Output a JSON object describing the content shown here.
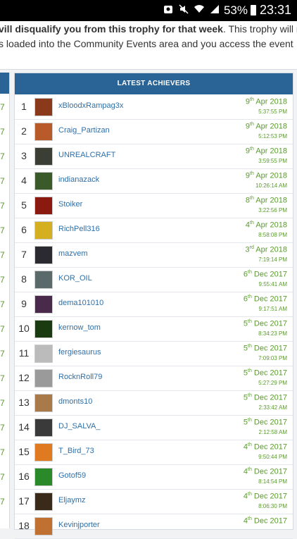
{
  "status_bar": {
    "battery_pct": "53%",
    "time": "23:31"
  },
  "intro": {
    "line1_bold": "vill disqualify you from this trophy for that week",
    "line1_rest": ". This trophy will not",
    "line2": "s loaded into the Community Events area and you access the event"
  },
  "left_column": {
    "number": "7"
  },
  "panel": {
    "title": "LATEST ACHIEVERS",
    "rows": [
      {
        "rank": "1",
        "user": "xBloodxRampag3x",
        "day": "9",
        "sfx": "th",
        "mon": "Apr 2018",
        "time": "5:37:55 PM",
        "avatar_color": "#8a3a1a"
      },
      {
        "rank": "2",
        "user": "Craig_Partizan",
        "day": "9",
        "sfx": "th",
        "mon": "Apr 2018",
        "time": "5:12:53 PM",
        "avatar_color": "#b85a2a"
      },
      {
        "rank": "3",
        "user": "UNREALCRAFT",
        "day": "9",
        "sfx": "th",
        "mon": "Apr 2018",
        "time": "3:59:55 PM",
        "avatar_color": "#3a3e34"
      },
      {
        "rank": "4",
        "user": "indianazack",
        "day": "9",
        "sfx": "th",
        "mon": "Apr 2018",
        "time": "10:26:14 AM",
        "avatar_color": "#3a5a2a"
      },
      {
        "rank": "5",
        "user": "Stoiker",
        "day": "8",
        "sfx": "th",
        "mon": "Apr 2018",
        "time": "3:22:56 PM",
        "avatar_color": "#8a1a10"
      },
      {
        "rank": "6",
        "user": "RichPell316",
        "day": "4",
        "sfx": "th",
        "mon": "Apr 2018",
        "time": "8:58:08 PM",
        "avatar_color": "#d4b020"
      },
      {
        "rank": "7",
        "user": "mazvem",
        "day": "3",
        "sfx": "rd",
        "mon": "Apr 2018",
        "time": "7:19:14 PM",
        "avatar_color": "#2a2a30"
      },
      {
        "rank": "8",
        "user": "KOR_OIL",
        "day": "6",
        "sfx": "th",
        "mon": "Dec 2017",
        "time": "9:55:41 AM",
        "avatar_color": "#5a6a6a"
      },
      {
        "rank": "9",
        "user": "dema101010",
        "day": "6",
        "sfx": "th",
        "mon": "Dec 2017",
        "time": "9:17:51 AM",
        "avatar_color": "#4a2a4a"
      },
      {
        "rank": "10",
        "user": "kernow_tom",
        "day": "5",
        "sfx": "th",
        "mon": "Dec 2017",
        "time": "8:34:23 PM",
        "avatar_color": "#1a3a10"
      },
      {
        "rank": "11",
        "user": "fergiesaurus",
        "day": "5",
        "sfx": "th",
        "mon": "Dec 2017",
        "time": "7:09:03 PM",
        "avatar_color": "#bbbbbb"
      },
      {
        "rank": "12",
        "user": "RocknRoll79",
        "day": "5",
        "sfx": "th",
        "mon": "Dec 2017",
        "time": "5:27:29 PM",
        "avatar_color": "#9a9a9a"
      },
      {
        "rank": "13",
        "user": "dmonts10",
        "day": "5",
        "sfx": "th",
        "mon": "Dec 2017",
        "time": "2:33:42 AM",
        "avatar_color": "#a87a4a"
      },
      {
        "rank": "14",
        "user": "DJ_SALVA_",
        "day": "5",
        "sfx": "th",
        "mon": "Dec 2017",
        "time": "2:12:58 AM",
        "avatar_color": "#3a3a3a"
      },
      {
        "rank": "15",
        "user": "T_Bird_73",
        "day": "4",
        "sfx": "th",
        "mon": "Dec 2017",
        "time": "9:50:44 PM",
        "avatar_color": "#e07a20"
      },
      {
        "rank": "16",
        "user": "Gotof59",
        "day": "4",
        "sfx": "th",
        "mon": "Dec 2017",
        "time": "8:14:54 PM",
        "avatar_color": "#2a8a2a"
      },
      {
        "rank": "17",
        "user": "Eljaymz",
        "day": "4",
        "sfx": "th",
        "mon": "Dec 2017",
        "time": "8:06:30 PM",
        "avatar_color": "#3a2a1a"
      },
      {
        "rank": "18",
        "user": "Kevinjporter",
        "day": "4",
        "sfx": "th",
        "mon": "Dec 2017",
        "time": "",
        "avatar_color": "#c07030"
      }
    ]
  },
  "colors": {
    "header": "#2a6496",
    "username": "#2f6fa7",
    "date": "#5a9a2d"
  }
}
